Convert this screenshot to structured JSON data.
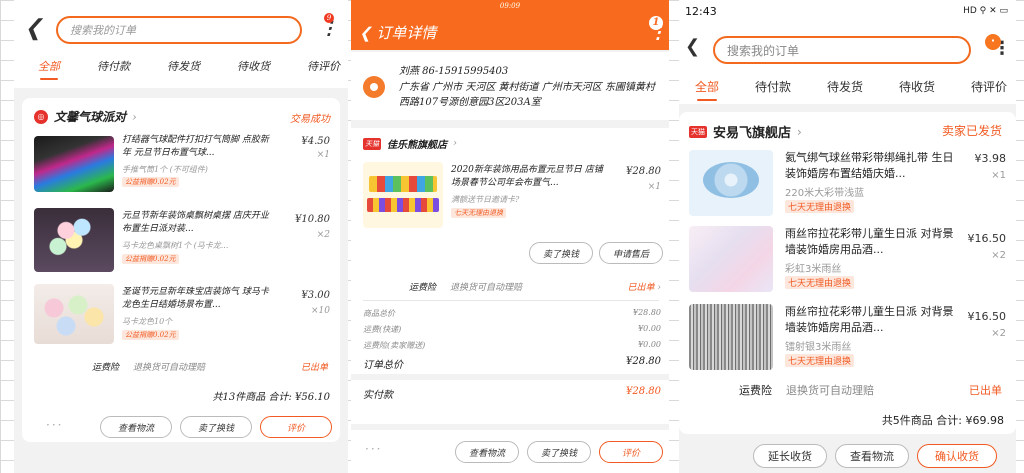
{
  "panel1": {
    "search_placeholder": "搜索我的订单",
    "badge": "9",
    "tabs": [
      "全部",
      "待付款",
      "待发货",
      "待收货",
      "待评价"
    ],
    "order": {
      "store": "文馨气球派对",
      "status": "交易成功",
      "items": [
        {
          "title": "打结器气球配件打扣打气筒脚 点胶新年 元旦节日布置气球...",
          "spec": "手推气筒1个 (不可组件)",
          "tag": "公益捐赠0.02元",
          "price": "¥4.50",
          "qty": "×1"
        },
        {
          "title": "元旦节新年装饰桌飘树桌摆 店庆开业布置生日派对装...",
          "spec": "马卡龙色桌飘树1个 (马卡龙...",
          "tag": "公益捐赠0.02元",
          "price": "¥10.80",
          "qty": "×2"
        },
        {
          "title": "圣诞节元旦新年珠宝店装饰气 球马卡龙色生日结婚场景布置...",
          "spec": "马卡龙色10个",
          "tag": "公益捐赠0.02元",
          "price": "¥3.00",
          "qty": "×10"
        }
      ],
      "insurance_label": "运费险",
      "insurance_text": "退换货可自动理赔",
      "insurance_status": "已出单",
      "total": "共13件商品 合计: ¥56.10",
      "buttons": [
        "查看物流",
        "卖了换钱",
        "评价"
      ],
      "more": "···"
    }
  },
  "panel2": {
    "status_bar": "09:09",
    "title": "订单详情",
    "badge": "1",
    "recipient": "刘燕  86-15915995403",
    "address": "广东省 广州市 天河区 黄村街道 广州市天河区 东圃镇黄村西路107号源创意园3区203A室",
    "store": "佳乐熊旗舰店",
    "item": {
      "title": "2020新年装饰用品布置元旦节日 店铺场景春节公司年会布置气...",
      "spec": "满额送节日邀请卡?",
      "tag": "七天无理由退换",
      "price": "¥28.80",
      "qty": "×1"
    },
    "buttons_top": [
      "卖了换钱",
      "申请售后"
    ],
    "insurance_label": "运费险",
    "insurance_text": "退换货可自动理赔",
    "insurance_status": "已出单",
    "summary": [
      {
        "label": "商品总价",
        "value": "¥28.80"
      },
      {
        "label": "运费(快递)",
        "value": "¥0.00"
      },
      {
        "label": "运费险(卖家赠送)",
        "value": "¥0.00"
      }
    ],
    "order_total_label": "订单总价",
    "order_total": "¥28.80",
    "paid_label": "实付款",
    "paid": "¥28.80",
    "buttons_bottom": [
      "查看物流",
      "卖了换钱",
      "评价"
    ]
  },
  "panel3": {
    "time": "12:43",
    "sys": "HD ⚲ ✕ ▭",
    "search_placeholder": "搜索我的订单",
    "badge": "·",
    "tabs": [
      "全部",
      "待付款",
      "待发货",
      "待收货",
      "待评价"
    ],
    "store": "安易飞旗舰店",
    "status": "卖家已发货",
    "items": [
      {
        "title": "氦气绑气球丝带彩带绑绳扎带 生日装饰婚房布置结婚庆婚...",
        "spec": "220米大彩带浅蓝",
        "tag": "七天无理由退换",
        "price": "¥3.98",
        "qty": "×1"
      },
      {
        "title": "雨丝帘拉花彩带儿童生日派 对背景墙装饰婚房用品酒...",
        "spec": "彩虹3米雨丝",
        "tag": "七天无理由退换",
        "price": "¥16.50",
        "qty": "×2"
      },
      {
        "title": "雨丝帘拉花彩带儿童生日派 对背景墙装饰婚房用品酒...",
        "spec": "镭射银3米雨丝",
        "tag": "七天无理由退换",
        "price": "¥16.50",
        "qty": "×2"
      }
    ],
    "insurance_label": "运费险",
    "insurance_text": "退换货可自动理赔",
    "insurance_status": "已出单",
    "total": "共5件商品 合计: ¥69.98",
    "buttons": [
      "延长收货",
      "查看物流",
      "确认收货"
    ]
  },
  "colors": {
    "accent": "#f15a22",
    "header": "#f86b1f"
  }
}
